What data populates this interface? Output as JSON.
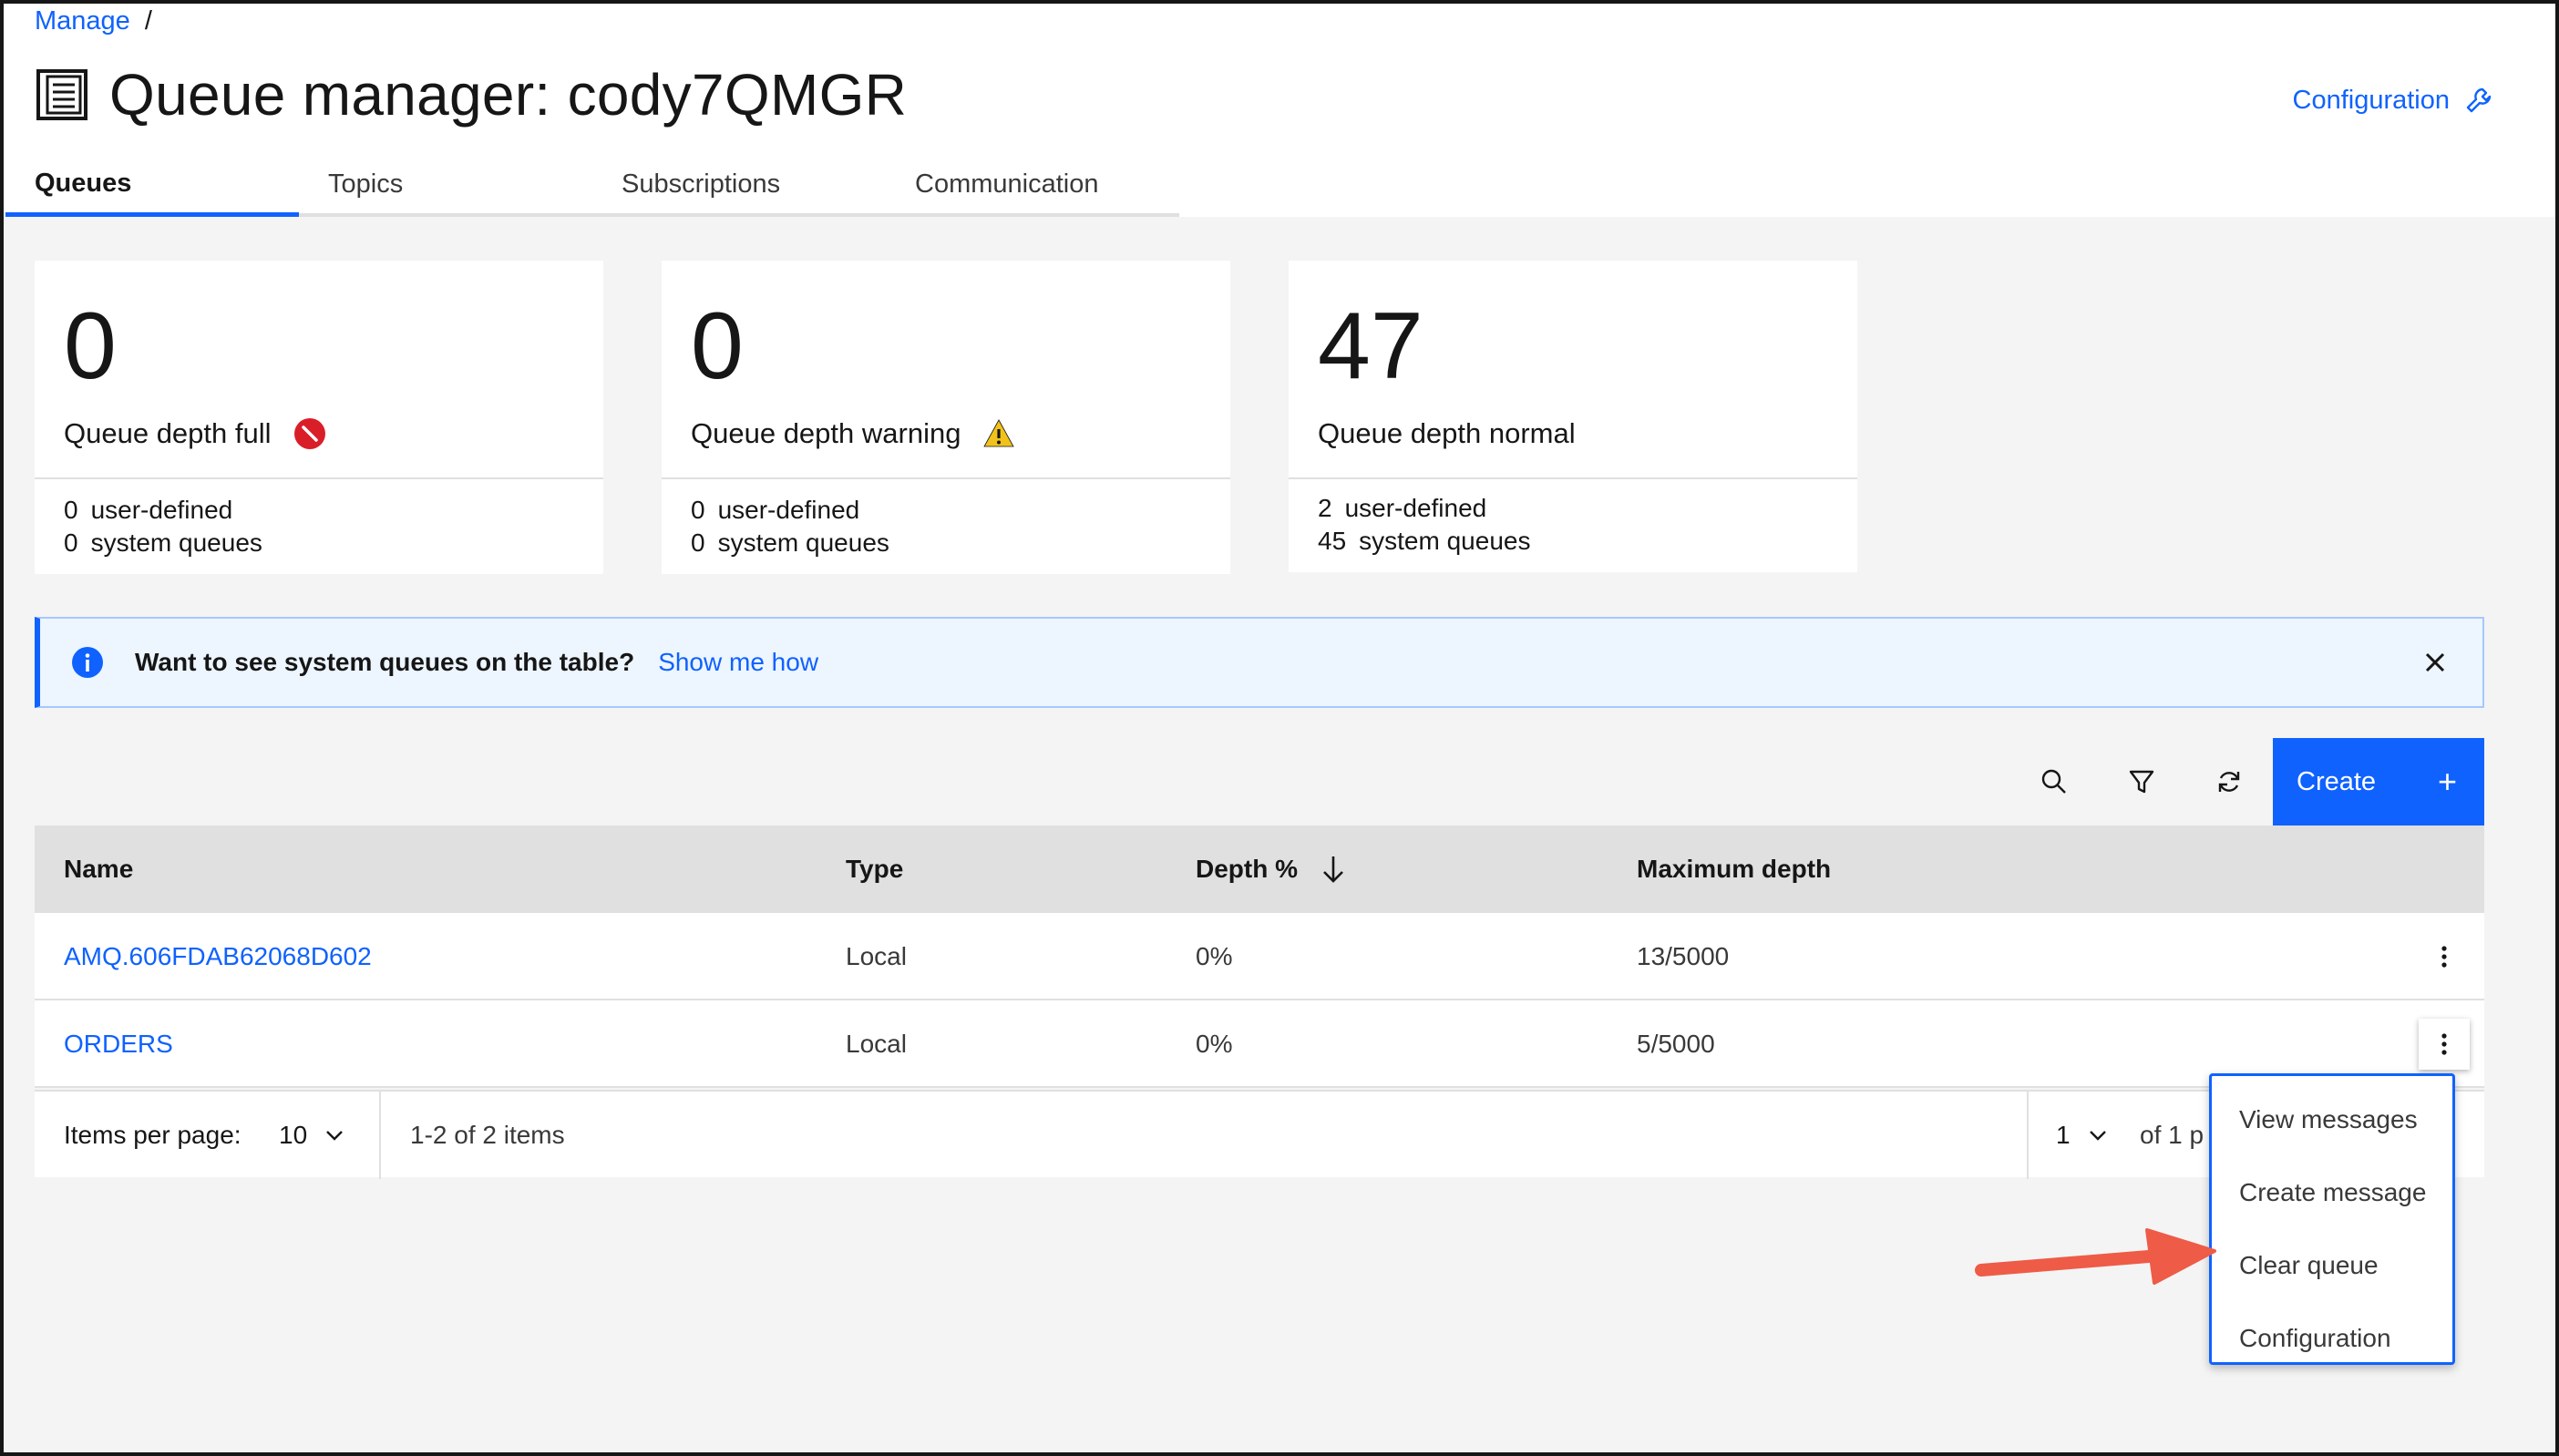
{
  "breadcrumb": {
    "manage": "Manage",
    "separator": "/"
  },
  "page": {
    "title": "Queue manager: cody7QMGR",
    "config_link": "Configuration"
  },
  "tabs": [
    {
      "label": "Queues",
      "active": true
    },
    {
      "label": "Topics"
    },
    {
      "label": "Subscriptions"
    },
    {
      "label": "Communication"
    }
  ],
  "tiles": [
    {
      "number": "0",
      "label": "Queue depth full",
      "status_icon": "error-icon",
      "user_defined": {
        "count": "0",
        "label": "user-defined"
      },
      "system": {
        "count": "0",
        "label": "system queues"
      }
    },
    {
      "number": "0",
      "label": "Queue depth warning",
      "status_icon": "warning-icon",
      "user_defined": {
        "count": "0",
        "label": "user-defined"
      },
      "system": {
        "count": "0",
        "label": "system queues"
      }
    },
    {
      "number": "47",
      "label": "Queue depth normal",
      "user_defined": {
        "count": "2",
        "label": "user-defined"
      },
      "system": {
        "count": "45",
        "label": "system queues"
      }
    }
  ],
  "notification": {
    "message": "Want to see system queues on the table?",
    "action": "Show me how"
  },
  "toolbar": {
    "create_label": "Create",
    "create_icon": "+"
  },
  "table": {
    "headers": {
      "name": "Name",
      "type": "Type",
      "depth": "Depth %",
      "max_depth": "Maximum depth"
    },
    "rows": [
      {
        "name": "AMQ.606FDAB62068D602",
        "type": "Local",
        "depth": "0%",
        "max_depth": "13/5000"
      },
      {
        "name": "ORDERS",
        "type": "Local",
        "depth": "0%",
        "max_depth": "5/5000"
      }
    ]
  },
  "pagination": {
    "items_per_page_label": "Items per page:",
    "items_per_page": "10",
    "range": "1-2 of 2 items",
    "page": "1",
    "of_pages": "of 1 p"
  },
  "overflow_menu": {
    "items": [
      "View messages",
      "Create message",
      "Clear queue",
      "Configuration"
    ]
  },
  "colors": {
    "accent": "#0f62fe",
    "error": "#da1e28",
    "warning": "#f1c21b",
    "annotation_arrow": "#ee5b47"
  }
}
